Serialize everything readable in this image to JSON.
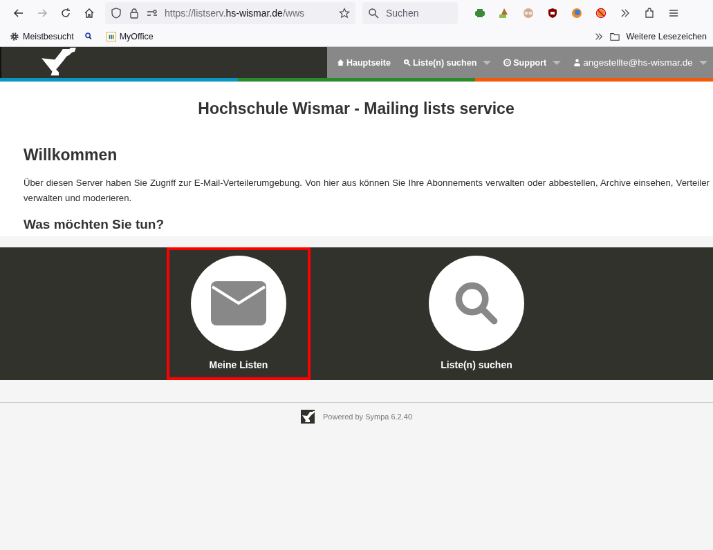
{
  "browser": {
    "url_prefix": "https://listserv.",
    "url_domain": "hs-wismar.de",
    "url_path": "/wws",
    "search_placeholder": "Suchen",
    "bookmarks": [
      {
        "label": "Meistbesucht",
        "kind": "gear"
      },
      {
        "kind": "search"
      },
      {
        "label": "MyOffice",
        "kind": "office"
      }
    ],
    "more_bookmarks": "Weitere Lesezeichen"
  },
  "nav": {
    "items": [
      {
        "label": "Hauptseite",
        "kind": "home",
        "dropdown": false
      },
      {
        "label": "Liste(n) suchen",
        "kind": "search",
        "dropdown": true
      },
      {
        "label": "Support",
        "kind": "lifebuoy",
        "dropdown": true
      },
      {
        "label": "angestellte@hs-wismar.de",
        "kind": "user",
        "dropdown": true
      }
    ]
  },
  "title": "Hochschule Wismar - Mailing lists service",
  "welcome": {
    "heading": "Willkommen",
    "text": "Über diesen Server haben Sie Zugriff zur E-Mail-Verteilerumgebung. Von hier aus können Sie Ihre Abonnements verwalten oder abbestellen, Archive einsehen, Verteiler verwalten und moderieren.",
    "question": "Was möchten Sie tun?"
  },
  "actions": [
    {
      "label": "Meine Listen",
      "kind": "envelope",
      "highlighted": true
    },
    {
      "label": "Liste(n) suchen",
      "kind": "magnifier",
      "highlighted": false
    }
  ],
  "footer": "Powered by Sympa 6.2.40"
}
